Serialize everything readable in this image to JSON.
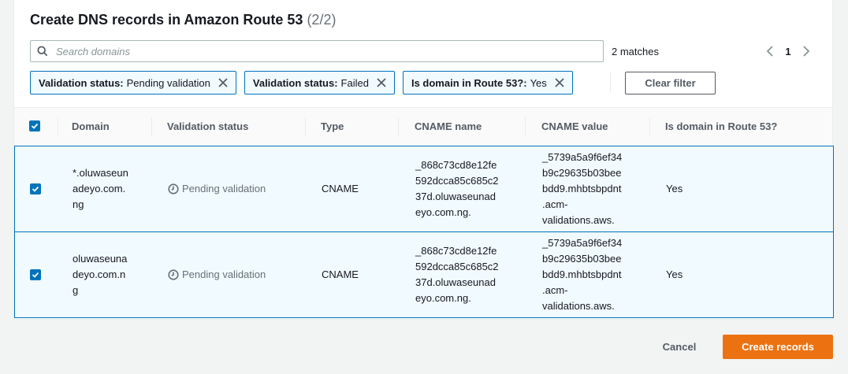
{
  "panel": {
    "title": "Create DNS records in Amazon Route 53",
    "count": "(2/2)"
  },
  "search": {
    "placeholder": "Search domains",
    "value": ""
  },
  "matches_text": "2 matches",
  "pagination": {
    "current_page": "1"
  },
  "filters": [
    {
      "key": "Validation status:",
      "value": "Pending validation"
    },
    {
      "key": "Validation status:",
      "value": "Failed"
    },
    {
      "key": "Is domain in Route 53?:",
      "value": "Yes"
    }
  ],
  "clear_filter_label": "Clear filter",
  "table": {
    "columns": [
      "Domain",
      "Validation status",
      "Type",
      "CNAME name",
      "CNAME value",
      "Is domain in Route 53?"
    ],
    "rows": [
      {
        "selected": true,
        "domain": [
          "*.oluwaseun",
          "adeyo.com.",
          "ng"
        ],
        "validation_status": "Pending validation",
        "type": "CNAME",
        "cname_name": [
          "_868c73cd8e12fe",
          "592dcca85c685c2",
          "37d.oluwaseunad",
          "eyo.com.ng."
        ],
        "cname_value": [
          "_5739a5a9f6ef34",
          "b9c29635b03bee",
          "bdd9.mhbtsbpdnt",
          ".acm-",
          "validations.aws."
        ],
        "in_route53": "Yes"
      },
      {
        "selected": true,
        "domain": [
          "oluwaseuna",
          "deyo.com.n",
          "g"
        ],
        "validation_status": "Pending validation",
        "type": "CNAME",
        "cname_name": [
          "_868c73cd8e12fe",
          "592dcca85c685c2",
          "37d.oluwaseunad",
          "eyo.com.ng."
        ],
        "cname_value": [
          "_5739a5a9f6ef34",
          "b9c29635b03bee",
          "bdd9.mhbtsbpdnt",
          ".acm-",
          "validations.aws."
        ],
        "in_route53": "Yes"
      }
    ]
  },
  "actions": {
    "cancel_label": "Cancel",
    "create_label": "Create records"
  },
  "colors": {
    "accent": "#0073bb",
    "primary_button": "#ec7211",
    "selected_row_bg": "#f1faff"
  }
}
